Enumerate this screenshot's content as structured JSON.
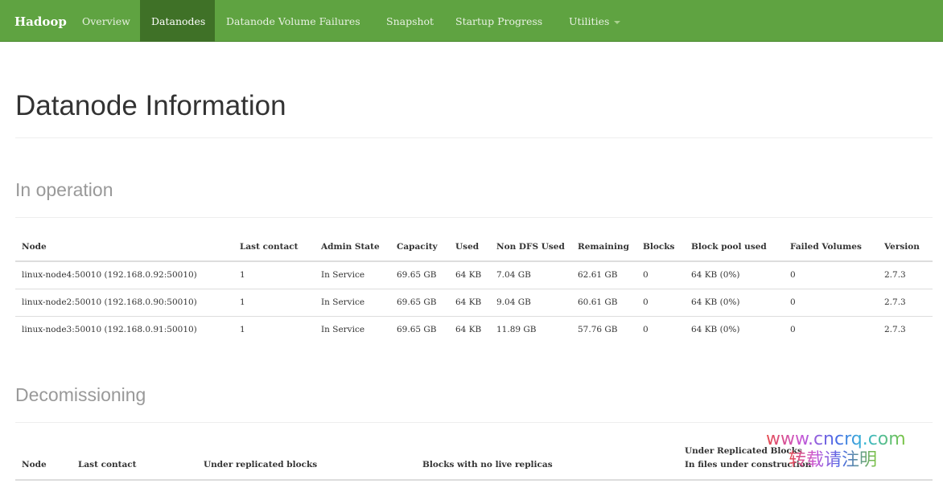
{
  "navbar": {
    "brand": "Hadoop",
    "items": [
      "Overview",
      "Datanodes",
      "Datanode Volume Failures",
      "Snapshot",
      "Startup Progress",
      "Utilities"
    ],
    "active": "Datanodes"
  },
  "page_title": "Datanode Information",
  "in_operation": {
    "heading": "In operation",
    "columns": [
      "Node",
      "Last contact",
      "Admin State",
      "Capacity",
      "Used",
      "Non DFS Used",
      "Remaining",
      "Blocks",
      "Block pool used",
      "Failed Volumes",
      "Version"
    ],
    "rows": [
      [
        "linux-node4:50010 (192.168.0.92:50010)",
        "1",
        "In Service",
        "69.65 GB",
        "64 KB",
        "7.04 GB",
        "62.61 GB",
        "0",
        "64 KB (0%)",
        "0",
        "2.7.3"
      ],
      [
        "linux-node2:50010 (192.168.0.90:50010)",
        "1",
        "In Service",
        "69.65 GB",
        "64 KB",
        "9.04 GB",
        "60.61 GB",
        "0",
        "64 KB (0%)",
        "0",
        "2.7.3"
      ],
      [
        "linux-node3:50010 (192.168.0.91:50010)",
        "1",
        "In Service",
        "69.65 GB",
        "64 KB",
        "11.89 GB",
        "57.76 GB",
        "0",
        "64 KB (0%)",
        "0",
        "2.7.3"
      ]
    ]
  },
  "decomissioning": {
    "heading": "Decomissioning",
    "columns": [
      "Node",
      "Last contact",
      "Under replicated blocks",
      "Blocks with no live replicas",
      "Under Replicated Blocks",
      "In files under construction"
    ]
  },
  "watermark": {
    "line1": "www.cncrq.com",
    "line2": "转载请注明"
  },
  "colors": {
    "navbar": "#5fa341",
    "navbar_active": "#3f7127"
  }
}
